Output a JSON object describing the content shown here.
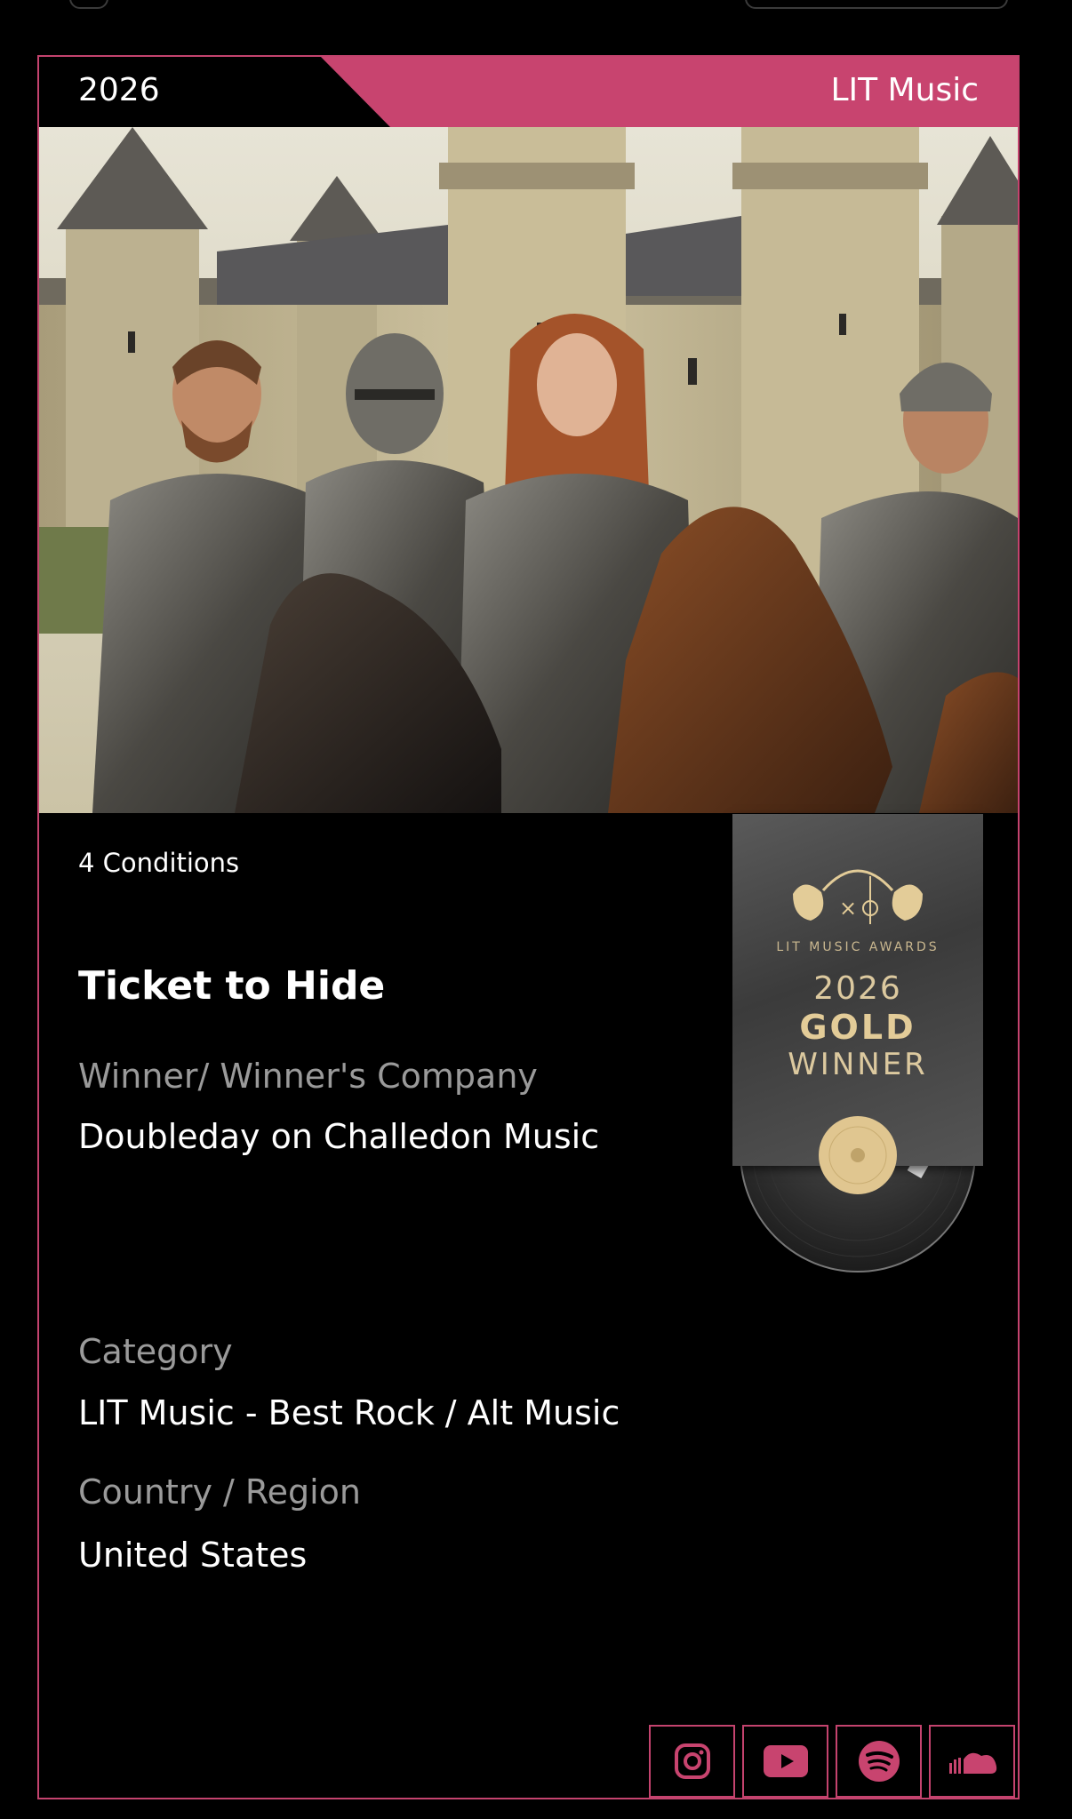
{
  "header": {
    "year": "2026",
    "brand": "LIT Music"
  },
  "entry": {
    "conditions": "4 Conditions",
    "title": "Ticket to Hide",
    "winner_label": "Winner/ Winner's Company",
    "winner_value": "Doubleday on Challedon Music",
    "category_label": "Category",
    "category_value": "LIT Music - Best Rock / Alt Music",
    "country_label": "Country / Region",
    "country_value": "United States"
  },
  "badge": {
    "org": "LIT MUSIC AWARDS",
    "year": "2026",
    "level": "GOLD",
    "status": "WINNER"
  },
  "colors": {
    "accent": "#c8446f",
    "badge_gold": "#e3cc98"
  },
  "socials": [
    {
      "name": "instagram-icon"
    },
    {
      "name": "youtube-icon"
    },
    {
      "name": "spotify-icon"
    },
    {
      "name": "soundcloud-icon"
    }
  ]
}
